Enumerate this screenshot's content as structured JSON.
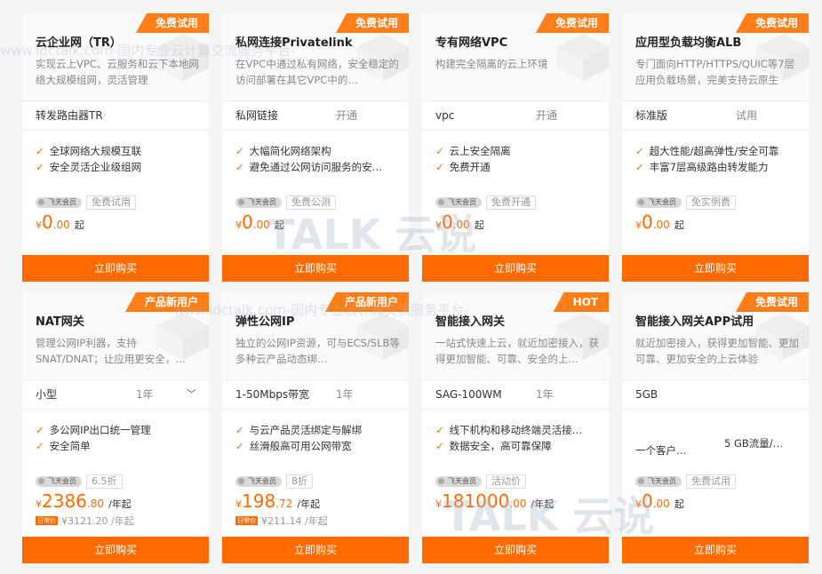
{
  "buy_label": "立即购买",
  "currency": "¥",
  "watermark": {
    "url_text": "www.idctalk.com-国内专业云计算交流服务平台-",
    "logo_text": "TALK 云说"
  },
  "cards": [
    {
      "badge": "免费试用",
      "title": "云企业网（TR）",
      "desc": "实现云上VPC、云服务和云下本地网络大规模组网，灵活管理",
      "spec1": "转发路由器TR",
      "spec2": "",
      "features": [
        "全球网络大规模互联",
        "安全灵活企业级组网"
      ],
      "vip": "飞天会员",
      "tag": "免费试用",
      "price_int": "0",
      "price_dec": ".00",
      "unit": "起",
      "orig": ""
    },
    {
      "badge": "免费试用",
      "title": "私网连接Privatelink",
      "desc": "在VPC中通过私有网络，安全稳定的访问部署在其它VPC中的…",
      "spec1": "私网链接",
      "spec2": "开通",
      "features": [
        "大幅简化网络架构",
        "避免通过公网访问服务的安…"
      ],
      "vip": "飞天会员",
      "tag": "免费公测",
      "price_int": "0",
      "price_dec": ".00",
      "unit": "起",
      "orig": ""
    },
    {
      "badge": "免费试用",
      "title": "专有网络VPC",
      "desc": "构建完全隔离的云上环境",
      "spec1": "vpc",
      "spec2": "开通",
      "features": [
        "云上安全隔离",
        "免费开通"
      ],
      "vip": "飞天会员",
      "tag": "免费开通",
      "price_int": "0",
      "price_dec": ".00",
      "unit": "起",
      "orig": ""
    },
    {
      "badge": "免费试用",
      "title": "应用型负载均衡ALB",
      "desc": "专门面向HTTP/HTTPS/QUIC等7层应用负载场景，完美支持云原生",
      "spec1": "标准版",
      "spec2": "试用",
      "features": [
        "超大性能/超高弹性/安全可靠",
        "丰富7层高级路由转发能力"
      ],
      "vip": "飞天会员",
      "tag": "免实例费",
      "price_int": "0",
      "price_dec": ".00",
      "unit": "起",
      "orig": ""
    },
    {
      "badge": "产品新用户",
      "title": "NAT网关",
      "desc": "管理公网IP利器，支持SNAT/DNAT；让应用更安全，…",
      "spec1": "小型",
      "spec2": "1年",
      "chev": true,
      "features": [
        "多公网IP出口统一管理",
        "安全简单"
      ],
      "vip": "飞天会员",
      "tag": "6.5折",
      "price_int": "2386",
      "price_dec": ".80",
      "unit": "/年起",
      "orig_badge": "日常价",
      "orig": "¥3121.20 /年起"
    },
    {
      "badge": "产品新用户",
      "title": "弹性公网IP",
      "desc": "独立的公网IP资源，可与ECS/SLB等多种云产品动态绑…",
      "spec1": "1-50Mbps带宽",
      "spec2": "1年",
      "features": [
        "与云产品灵活绑定与解绑",
        "丝滑般高可用公网带宽"
      ],
      "vip": "飞天会员",
      "tag": "8折",
      "price_int": "198",
      "price_dec": ".72",
      "unit": "/年起",
      "orig_badge": "日常价",
      "orig": "¥211.14 /年起"
    },
    {
      "badge": "HOT",
      "title": "智能接入网关",
      "desc": "一站式快速上云，就近加密接入，获得更加智能、可靠、安全的上…",
      "spec1": "SAG-100WM",
      "spec2": "1年",
      "features": [
        "线下机构和移动终端灵活接…",
        "数据安全，高可靠保障"
      ],
      "vip": "飞天会员",
      "tag": "活动价",
      "price_int": "181000",
      "price_dec": ".00",
      "unit": "/年起",
      "orig": ""
    },
    {
      "badge": "免费试用",
      "title": "智能接入网关APP试用",
      "desc": "就近加密接入，获得更加智能、更加可靠、更加安全的上云体验",
      "spec1": "5GB",
      "spec2": "",
      "features": [],
      "feat_a": "一个客户…",
      "feat_b": "5 GB流量/…",
      "vip": "飞天会员",
      "tag": "免费试用",
      "price_int": "0",
      "price_dec": ".00",
      "unit": "起",
      "orig": ""
    }
  ]
}
